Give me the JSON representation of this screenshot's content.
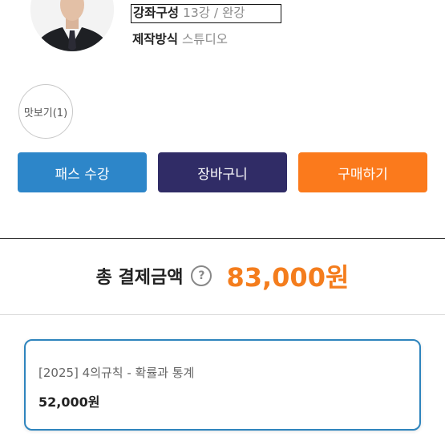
{
  "course_info": {
    "composition_label": "강좌구성",
    "composition_value": "13강 / 완강",
    "production_label": "제작방식",
    "production_value": "스튜디오"
  },
  "preview_button": {
    "label": "맛보기(1)"
  },
  "actions": {
    "pass_label": "패스 수강",
    "cart_label": "장바구니",
    "buy_label": "구매하기"
  },
  "total": {
    "label": "총 결제금액",
    "help_icon": "question-circle-icon",
    "help_glyph": "?",
    "amount": "83,000원"
  },
  "course_item": {
    "title": "[2025] 4의규칙 - 확률과 통계",
    "price": "52,000원"
  },
  "colors": {
    "pass_button": "#2d86c9",
    "cart_button": "#302c66",
    "buy_button": "#fb7a1c",
    "amount": "#f47d1d",
    "card_border": "#2e84bd"
  }
}
